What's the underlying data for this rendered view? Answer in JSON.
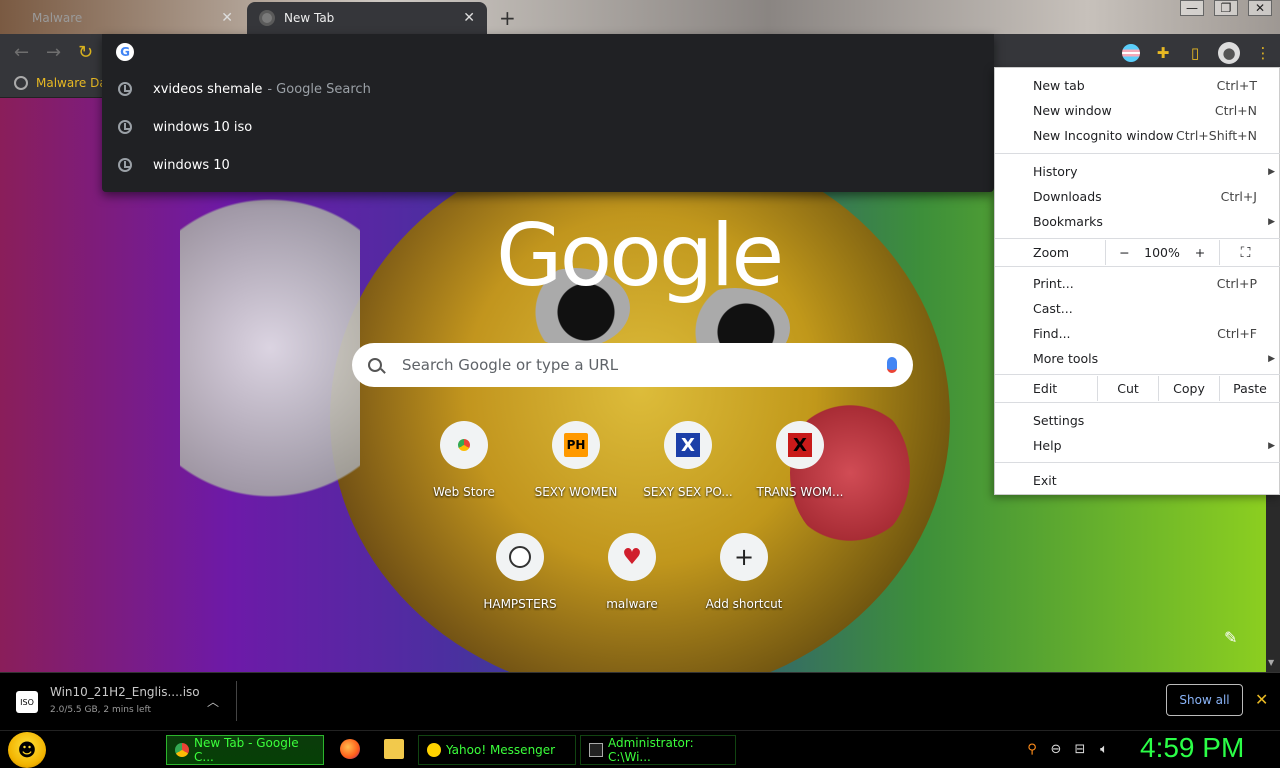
{
  "tabs": [
    {
      "title": "Malware"
    },
    {
      "title": "New Tab"
    }
  ],
  "toolbar": {
    "address_value": ""
  },
  "bookmarks": {
    "items": [
      {
        "label": "Malware Da"
      }
    ]
  },
  "omnibox": {
    "suggestions": [
      {
        "text": "xvideos shemale",
        "suffix": "- Google Search"
      },
      {
        "text": "windows 10 iso",
        "suffix": ""
      },
      {
        "text": "windows 10",
        "suffix": ""
      }
    ]
  },
  "ntp": {
    "logo": "Google",
    "search_placeholder": "Search Google or type a URL",
    "shortcuts": [
      {
        "label": "Web Store",
        "icon": "chrome-web-store-icon"
      },
      {
        "label": "SEXY WOMEN",
        "icon": "ph-icon",
        "glyph": "PH"
      },
      {
        "label": "SEXY SEX PO...",
        "icon": "x-blue-icon",
        "glyph": "X"
      },
      {
        "label": "TRANS WOM...",
        "icon": "x-red-icon",
        "glyph": "X"
      },
      {
        "label": "HAMPSTERS",
        "icon": "hamster-icon"
      },
      {
        "label": "malware",
        "icon": "heart-icon",
        "glyph": "♥"
      },
      {
        "label": "Add shortcut",
        "icon": "plus-icon",
        "glyph": "+"
      }
    ]
  },
  "menu": {
    "new_tab": "New tab",
    "new_tab_sc": "Ctrl+T",
    "new_window": "New window",
    "new_window_sc": "Ctrl+N",
    "new_incognito": "New Incognito window",
    "new_incognito_sc": "Ctrl+Shift+N",
    "history": "History",
    "downloads": "Downloads",
    "downloads_sc": "Ctrl+J",
    "bookmarks": "Bookmarks",
    "zoom": "Zoom",
    "zoom_minus": "−",
    "zoom_value": "100%",
    "zoom_plus": "+",
    "print": "Print...",
    "print_sc": "Ctrl+P",
    "cast": "Cast...",
    "find": "Find...",
    "find_sc": "Ctrl+F",
    "more_tools": "More tools",
    "edit": "Edit",
    "cut": "Cut",
    "copy": "Copy",
    "paste": "Paste",
    "settings": "Settings",
    "help": "Help",
    "exit": "Exit"
  },
  "download": {
    "filename": "Win10_21H2_Englis....iso",
    "status": "2.0/5.5 GB, 2 mins left",
    "file_badge": "ISO",
    "show_all": "Show all"
  },
  "taskbar": {
    "tasks": [
      {
        "label": "New Tab - Google C..."
      },
      {
        "label": "Yahoo! Messenger"
      },
      {
        "label": "Administrator: C:\\Wi..."
      }
    ],
    "clock": "4:59 PM"
  },
  "colors": {
    "accent": "#e8b923",
    "clock": "#2bff47",
    "menu_bg": "#ffffff",
    "toolbar": "#35363a"
  }
}
